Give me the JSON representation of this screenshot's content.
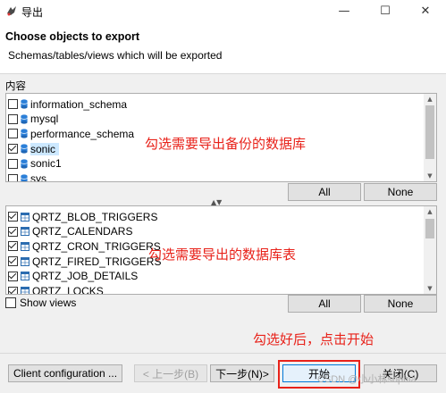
{
  "window": {
    "title": "导出",
    "minimize_glyph": "—",
    "maximize_glyph": "☐",
    "close_glyph": "✕"
  },
  "header": {
    "title": "Choose objects to export",
    "subtitle": "Schemas/tables/views which will be exported"
  },
  "content_label": "内容",
  "schemas": [
    {
      "name": "information_schema",
      "checked": false
    },
    {
      "name": "mysql",
      "checked": false
    },
    {
      "name": "performance_schema",
      "checked": false
    },
    {
      "name": "sonic",
      "checked": true,
      "selected": true
    },
    {
      "name": "sonic1",
      "checked": false
    },
    {
      "name": "sys",
      "checked": false
    }
  ],
  "schema_buttons": {
    "all": "All",
    "none": "None"
  },
  "tables": [
    {
      "name": "QRTZ_BLOB_TRIGGERS",
      "checked": true
    },
    {
      "name": "QRTZ_CALENDARS",
      "checked": true
    },
    {
      "name": "QRTZ_CRON_TRIGGERS",
      "checked": true
    },
    {
      "name": "QRTZ_FIRED_TRIGGERS",
      "checked": true
    },
    {
      "name": "QRTZ_JOB_DETAILS",
      "checked": true
    },
    {
      "name": "QRTZ_LOCKS",
      "checked": true
    }
  ],
  "table_buttons": {
    "all": "All",
    "none": "None"
  },
  "show_views": {
    "label": "Show views",
    "checked": false
  },
  "annotations": {
    "schemas": "勾选需要导出备份的数据库",
    "tables": "勾选需要导出的数据库表",
    "start": "勾选好后，点击开始"
  },
  "footer": {
    "client_config": "Client configuration ...",
    "back": "< 上一步(B)",
    "next": "下一步(N)>",
    "start": "开始",
    "cancel": "关闭(C)"
  },
  "watermark": "CSDN @小小林sophia",
  "colors": {
    "annotation": "#e8221a",
    "selection": "#cce8ff",
    "db_icon": "#2b7fd8"
  }
}
